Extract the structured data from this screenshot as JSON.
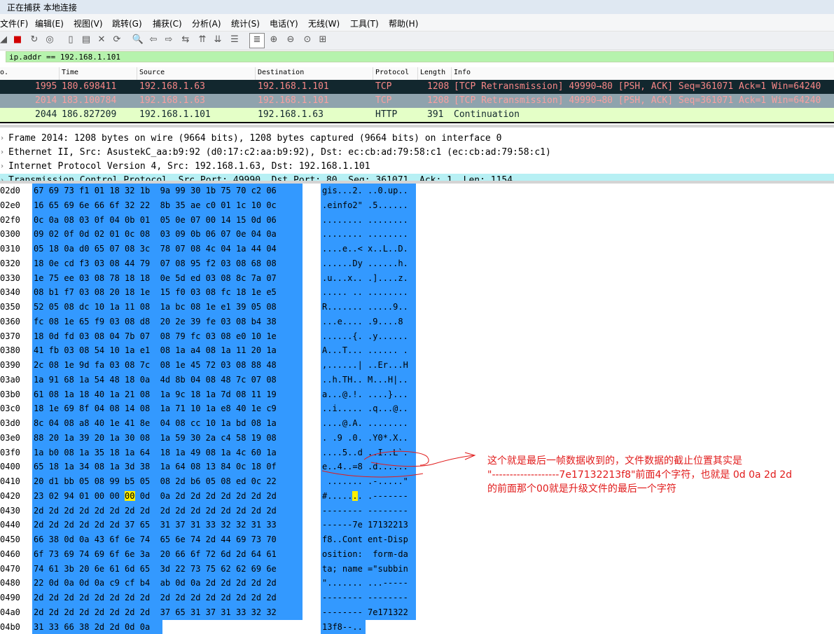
{
  "window": {
    "title": "正在捕获 本地连接"
  },
  "menu": [
    "文件(F)",
    "编辑(E)",
    "视图(V)",
    "跳转(G)",
    "捕获(C)",
    "分析(A)",
    "统计(S)",
    "电话(Y)",
    "无线(W)",
    "工具(T)",
    "帮助(H)"
  ],
  "toolbar": {
    "icons": [
      "shark-fin-icon",
      "stop-capture-icon",
      "restart-capture-icon",
      "options-gear-icon",
      "open-file-icon",
      "save-file-icon",
      "close-file-icon",
      "reload-icon",
      "find-packet-icon",
      "go-back-icon",
      "go-forward-icon",
      "go-to-packet-icon",
      "go-first-icon",
      "go-last-icon",
      "autoscroll-icon",
      "colorize-icon",
      "zoom-in-icon",
      "zoom-out-icon",
      "zoom-normal-icon",
      "resize-columns-icon"
    ],
    "glyphs": [
      "◢",
      "■",
      "↻",
      "◎",
      "▯",
      "▤",
      "✕",
      "⟳",
      "🔍",
      "⇦",
      "⇨",
      "⇆",
      "⇈",
      "⇊",
      "☰",
      "≣",
      "⊕",
      "⊖",
      "⊙",
      "⊞"
    ]
  },
  "filter": {
    "value": "ip.addr == 192.168.1.101"
  },
  "packet_list": {
    "columns": [
      "o.",
      "Time",
      "Source",
      "Destination",
      "Protocol",
      "Length",
      "Info"
    ],
    "rows": [
      {
        "no": "1995",
        "time": "180.698411",
        "src": "192.168.1.63",
        "dst": "192.168.1.101",
        "proto": "TCP",
        "len": "1208",
        "info": "[TCP Retransmission] 49990→80 [PSH, ACK] Seq=361071 Ack=1 Win=64240",
        "bg": "#12272e",
        "fg": "#f78787"
      },
      {
        "no": "2014",
        "time": "183.100784",
        "src": "192.168.1.63",
        "dst": "192.168.1.101",
        "proto": "TCP",
        "len": "1208",
        "info": "[TCP Retransmission] 49990→80 [PSH, ACK] Seq=361071 Ack=1 Win=64240",
        "bg": "#8fa3ad",
        "fg": "#f7a0a0"
      },
      {
        "no": "2044",
        "time": "186.827209",
        "src": "192.168.1.101",
        "dst": "192.168.1.63",
        "proto": "HTTP",
        "len": "391",
        "info": "Continuation",
        "bg": "#e4ffc7",
        "fg": "#12272e"
      }
    ]
  },
  "details": [
    "Frame 2014: 1208 bytes on wire (9664 bits), 1208 bytes captured (9664 bits) on interface 0",
    "Ethernet II, Src: AsustekC_aa:b9:92 (d0:17:c2:aa:b9:92), Dst: ec:cb:ad:79:58:c1 (ec:cb:ad:79:58:c1)",
    "Internet Protocol Version 4, Src: 192.168.1.63, Dst: 192.168.1.101",
    "Transmission Control Protocol, Src Port: 49990, Dst Port: 80, Seq: 361071, Ack: 1, Len: 1154"
  ],
  "bytes": [
    [
      "02d0",
      "67 69 73 f1 01 18 32 1b  9a 99 30 1b 75 70 c2 06",
      "gis...2. ..0.up.."
    ],
    [
      "02e0",
      "16 65 69 6e 66 6f 32 22  8b 35 ae c0 01 1c 10 0c",
      ".einfo2\" .5......"
    ],
    [
      "02f0",
      "0c 0a 08 03 0f 04 0b 01  05 0e 07 00 14 15 0d 06",
      "........ ........"
    ],
    [
      "0300",
      "09 02 0f 0d 02 01 0c 08  03 09 0b 06 07 0e 04 0a",
      "........ ........"
    ],
    [
      "0310",
      "05 18 0a d0 65 07 08 3c  78 07 08 4c 04 1a 44 04",
      "....e..< x..L..D."
    ],
    [
      "0320",
      "18 0e cd f3 03 08 44 79  07 08 95 f2 03 08 68 08",
      "......Dy ......h."
    ],
    [
      "0330",
      "1e 75 ee 03 08 78 18 18  0e 5d ed 03 08 8c 7a 07",
      ".u...x.. .]....z."
    ],
    [
      "0340",
      "08 b1 f7 03 08 20 18 1e  15 f0 03 08 fc 18 1e e5",
      "..... .. ........"
    ],
    [
      "0350",
      "52 05 08 dc 10 1a 11 08  1a bc 08 1e e1 39 05 08",
      "R....... .....9.."
    ],
    [
      "0360",
      "fc 08 1e 65 f9 03 08 d8  20 2e 39 fe 03 08 b4 38",
      "...e.... .9....8"
    ],
    [
      "0370",
      "18 0d fd 03 08 04 7b 07  08 79 fc 03 08 e0 10 1e",
      "......{. .y......"
    ],
    [
      "0380",
      "41 fb 03 08 54 10 1a e1  08 1a a4 08 1a 11 20 1a",
      "A...T... ...... ."
    ],
    [
      "0390",
      "2c 08 1e 9d fa 03 08 7c  08 1e 45 72 03 08 88 48",
      ",......| ..Er...H"
    ],
    [
      "03a0",
      "1a 91 68 1a 54 48 18 0a  4d 8b 04 08 48 7c 07 08",
      "..h.TH.. M...H|.."
    ],
    [
      "03b0",
      "61 08 1a 18 40 1a 21 08  1a 9c 18 1a 7d 08 11 19",
      "a...@.!. ....}..."
    ],
    [
      "03c0",
      "18 1e 69 8f 04 08 14 08  1a 71 10 1a e8 40 1e c9",
      "..i..... .q...@.."
    ],
    [
      "03d0",
      "8c 04 08 a8 40 1e 41 8e  04 08 cc 10 1a bd 08 1a",
      "....@.A. ........"
    ],
    [
      "03e0",
      "88 20 1a 39 20 1a 30 08  1a 59 30 2a c4 58 19 08",
      ". .9 .0. .Y0*.X.."
    ],
    [
      "03f0",
      "1a b0 08 1a 35 18 1a 64  18 1a 49 08 1a 4c 60 1a",
      "....5..d ..I..L`."
    ],
    [
      "0400",
      "65 18 1a 34 08 1a 3d 38  1a 64 08 13 84 0c 18 0f",
      "e..4..=8 .d......"
    ],
    [
      "0410",
      "20 d1 bb 05 08 99 b5 05  08 2d b6 05 08 ed 0c 22",
      " ....... .-.....\""
    ],
    [
      "0420",
      "23 02 94 01 00 00 00 0d  0a 2d 2d 2d 2d 2d 2d 2d",
      "#....... .-------"
    ],
    [
      "0430",
      "2d 2d 2d 2d 2d 2d 2d 2d  2d 2d 2d 2d 2d 2d 2d 2d",
      "-------- --------"
    ],
    [
      "0440",
      "2d 2d 2d 2d 2d 2d 37 65  31 37 31 33 32 32 31 33",
      "------7e 17132213"
    ],
    [
      "0450",
      "66 38 0d 0a 43 6f 6e 74  65 6e 74 2d 44 69 73 70",
      "f8..Cont ent-Disp"
    ],
    [
      "0460",
      "6f 73 69 74 69 6f 6e 3a  20 66 6f 72 6d 2d 64 61",
      "osition:  form-da"
    ],
    [
      "0470",
      "74 61 3b 20 6e 61 6d 65  3d 22 73 75 62 62 69 6e",
      "ta; name =\"subbin"
    ],
    [
      "0480",
      "22 0d 0a 0d 0a c9 cf b4  ab 0d 0a 2d 2d 2d 2d 2d",
      "\"....... ...-----"
    ],
    [
      "0490",
      "2d 2d 2d 2d 2d 2d 2d 2d  2d 2d 2d 2d 2d 2d 2d 2d",
      "-------- --------"
    ],
    [
      "04a0",
      "2d 2d 2d 2d 2d 2d 2d 2d  37 65 31 37 31 33 32 32",
      "-------- 7e171322"
    ],
    [
      "04b0",
      "31 33 66 38 2d 2d 0d 0a",
      "13f8--.."
    ]
  ],
  "annotation": {
    "line1": "这个就是最后一帧数据收到的，文件数据的截止位置其实是",
    "line2": "\"-------------------7e17132213f8\"前面4个字符，也就是 0d 0a 2d 2d",
    "line3": "的前面那个00就是升级文件的最后一个字符"
  }
}
